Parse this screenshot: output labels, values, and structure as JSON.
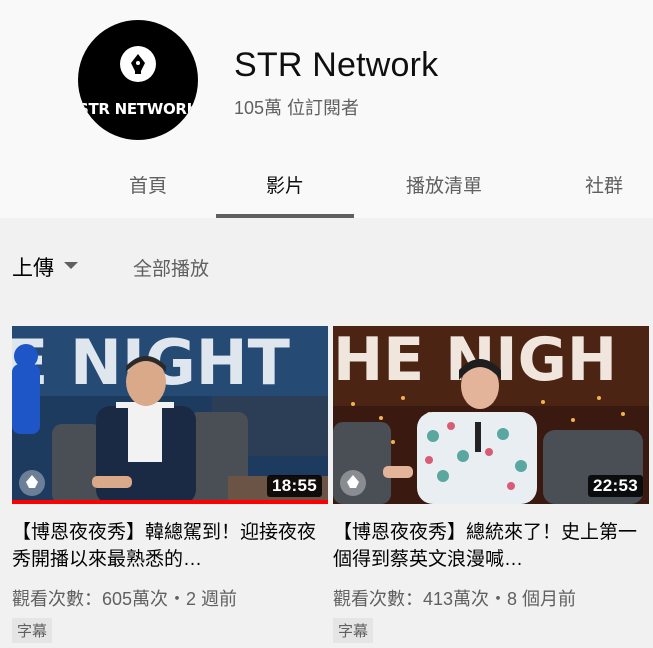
{
  "channel": {
    "name": "STR Network",
    "subscribers": "105萬 位訂閱者",
    "logo_text": "STR NETWORK"
  },
  "tabs": [
    {
      "label": "首頁",
      "active": false
    },
    {
      "label": "影片",
      "active": true
    },
    {
      "label": "播放清單",
      "active": false
    },
    {
      "label": "社群",
      "active": false
    }
  ],
  "toolbar": {
    "sort_label": "上傳",
    "play_all_label": "全部播放"
  },
  "videos": [
    {
      "title": "【博恩夜夜秀】韓總駕到！迎接夜夜秀開播以來最熟悉的…",
      "duration": "18:55",
      "meta": "觀看次數：605萬次・2 週前",
      "badge": "字幕",
      "watched_fraction": 1.0
    },
    {
      "title": "【博恩夜夜秀】總統來了！史上第一個得到蔡英文浪漫喊…",
      "duration": "22:53",
      "meta": "觀看次數：413萬次・8 個月前",
      "badge": "字幕",
      "watched_fraction": 0
    }
  ],
  "colors": {
    "page_bg": "#f1f1f1",
    "header_bg": "#f9f9f9",
    "progress_red": "#ff0000"
  }
}
